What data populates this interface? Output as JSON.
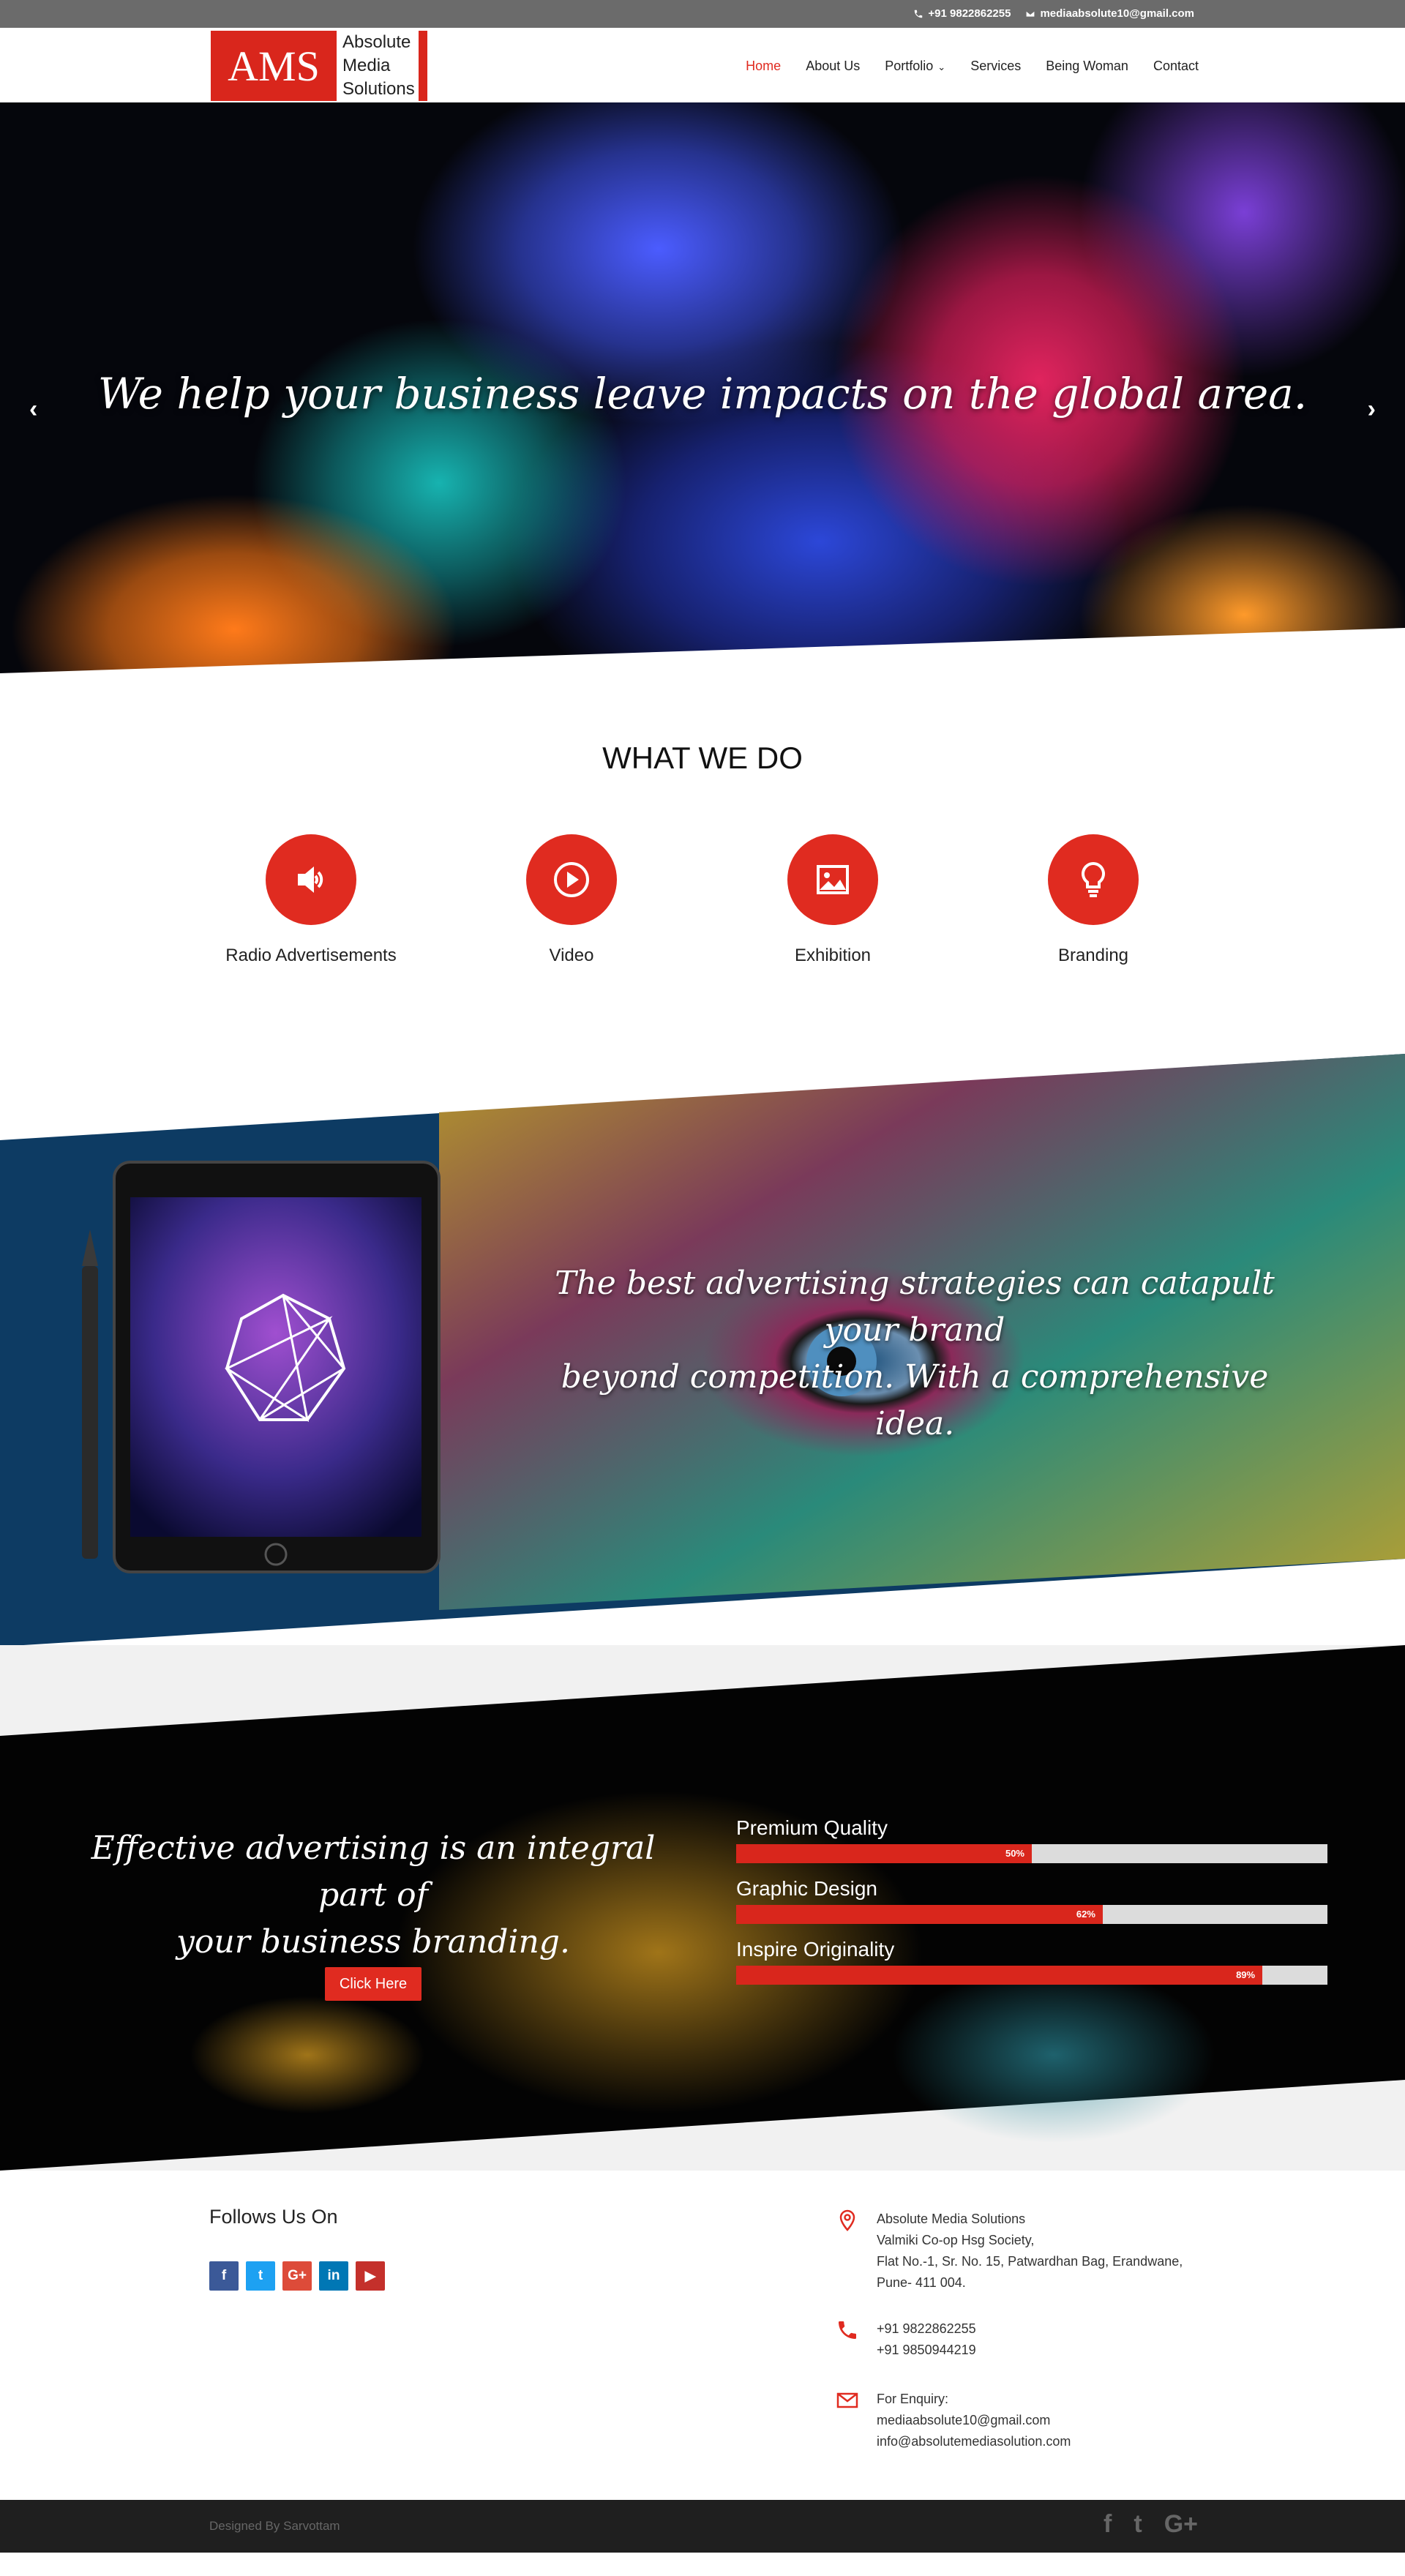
{
  "topbar": {
    "phone": "+91 9822862255",
    "email": "mediaabsolute10@gmail.com"
  },
  "logo": {
    "abbr": "AMS",
    "line1": "Absolute",
    "line2": "Media",
    "line3": "Solutions"
  },
  "nav": [
    {
      "label": "Home",
      "active": true
    },
    {
      "label": "About Us"
    },
    {
      "label": "Portfolio",
      "has_dropdown": true
    },
    {
      "label": "Services"
    },
    {
      "label": "Being Woman"
    },
    {
      "label": "Contact"
    }
  ],
  "hero": {
    "headline": "We help your business leave impacts on the global area.",
    "prev": "‹",
    "next": "›"
  },
  "what_we_do": {
    "title": "WHAT WE DO",
    "services": [
      {
        "label": "Radio Advertisements",
        "icon": "speaker-icon"
      },
      {
        "label": "Video",
        "icon": "play-icon"
      },
      {
        "label": "Exhibition",
        "icon": "image-icon"
      },
      {
        "label": "Branding",
        "icon": "lightbulb-icon"
      }
    ]
  },
  "strategy": {
    "line1": "The best advertising strategies can catapult your brand",
    "line2": "beyond competition. With a comprehensive idea."
  },
  "branding": {
    "line1": "Effective advertising is an integral part of",
    "line2": "your business branding.",
    "button": "Click Here",
    "bars": [
      {
        "name": "Premium Quality",
        "value": 50,
        "label": "50%"
      },
      {
        "name": "Graphic Design",
        "value": 62,
        "label": "62%"
      },
      {
        "name": "Inspire Originality",
        "value": 89,
        "label": "89%"
      }
    ]
  },
  "footer": {
    "follow_title": "Follows Us On",
    "social": [
      {
        "glyph": "f",
        "color": "#3b5998",
        "name": "facebook"
      },
      {
        "glyph": "t",
        "color": "#1da1f2",
        "name": "twitter"
      },
      {
        "glyph": "G+",
        "color": "#dd4b39",
        "name": "google-plus"
      },
      {
        "glyph": "in",
        "color": "#0077b5",
        "name": "linkedin"
      },
      {
        "glyph": "▶",
        "color": "#c4302b",
        "name": "youtube"
      }
    ],
    "address": [
      "Absolute Media Solutions",
      "Valmiki Co-op Hsg Society,",
      "Flat No.-1, Sr. No. 15, Patwardhan Bag, Erandwane,",
      "Pune- 411 004."
    ],
    "phones": [
      "+91 9822862255",
      "+91 9850944219"
    ],
    "enquiry": [
      "For Enquiry:",
      "mediaabsolute10@gmail.com",
      "info@absolutemediasolution.com"
    ],
    "credit": "Designed By Sarvottam",
    "bottom_icons": [
      "f",
      "t",
      "G+"
    ]
  },
  "colors": {
    "accent": "#e02b20",
    "topbar": "#6b6b6b",
    "footer_bottom": "#1f1f1f"
  }
}
